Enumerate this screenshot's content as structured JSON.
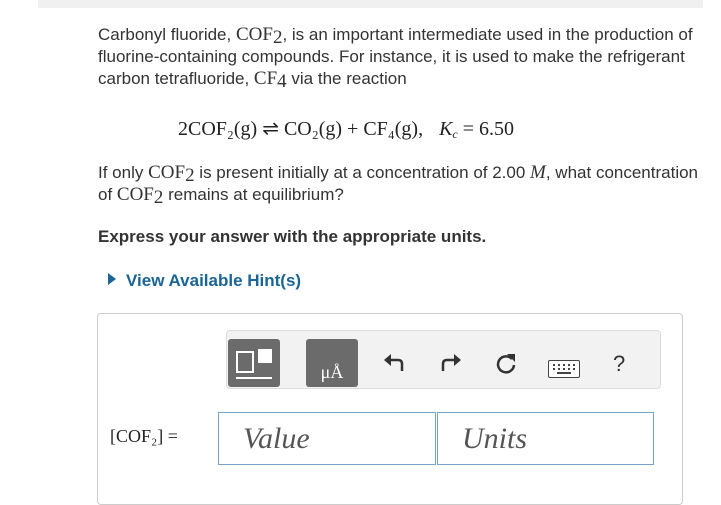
{
  "question": {
    "intro_1": "Carbonyl fluoride, ",
    "intro_chem_1": "COF",
    "intro_sub_1": "2",
    "intro_2": ", is an important intermediate used in the production of fluorine-containing compounds. For instance, it is used to make the refrigerant carbon tetrafluoride, ",
    "intro_chem_2": "CF",
    "intro_sub_2": "4",
    "intro_3": " via the reaction",
    "equation": "2COF₂(g) ⇌ CO₂(g) + CF₄(g),",
    "kc": "K",
    "kc_sub": "c",
    "kc_value": " = 6.50",
    "ask_1": "If only ",
    "ask_chem_1": "COF",
    "ask_sub_1": "2",
    "ask_2": " is present initially at a concentration of 2.00 ",
    "ask_m": "M",
    "ask_3": ", what concentration of ",
    "ask_chem_2": "COF",
    "ask_sub_2": "2",
    "ask_4": " remains at equilibrium?"
  },
  "instructions": "Express your answer with the appropriate units.",
  "hint_link": "View Available Hint(s)",
  "toolbar": {
    "units_label": "μÅ",
    "help": "?"
  },
  "answer": {
    "label": "[COF₂] =",
    "value_placeholder": "Value",
    "units_placeholder": "Units"
  },
  "colors": {
    "link": "#1a6496",
    "tool_button": "#6b6b6b",
    "input_border": "#7aa3c9"
  },
  "icons": [
    "templates-icon",
    "units-icon",
    "undo-icon",
    "redo-icon",
    "reset-icon",
    "keyboard-icon",
    "help-icon"
  ]
}
